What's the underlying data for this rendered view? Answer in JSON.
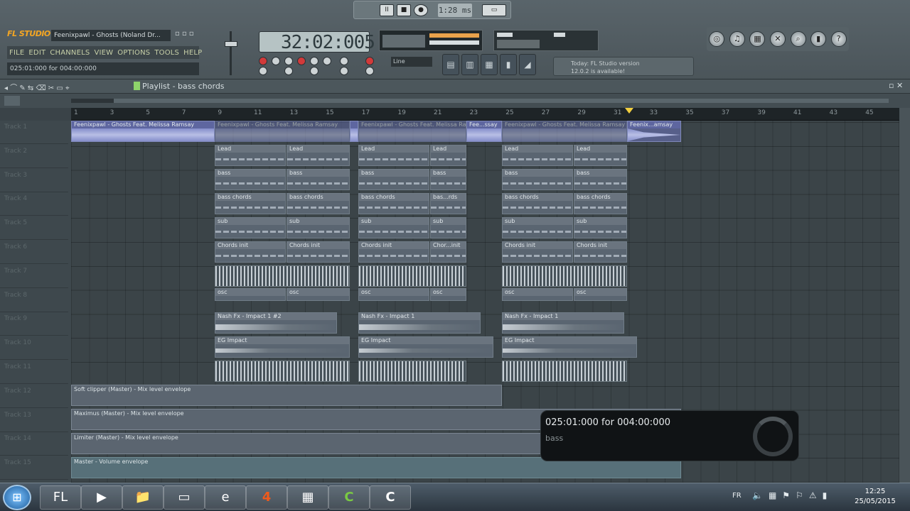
{
  "app": {
    "logo": "FL STUDIO",
    "song_title": "Feenixpawl - Ghosts (Noland Dr...",
    "menu": [
      "FILE",
      "EDIT",
      "CHANNELS",
      "VIEW",
      "OPTIONS",
      "TOOLS",
      "HELP"
    ],
    "hint_bar": "025:01:000 for 004:00:000",
    "tempo_display": "32:02:005",
    "mode_select": "Line",
    "news": [
      "Today: FL Studio version",
      "12.0.2 is available!"
    ]
  },
  "transport": {
    "pause": "II",
    "stop": "■",
    "record": "●",
    "mini_time": "1:28 ms"
  },
  "playlist": {
    "title": "Playlist - bass chords",
    "bars": [
      "1",
      "3",
      "5",
      "7",
      "9",
      "11",
      "13",
      "15",
      "17",
      "19",
      "21",
      "23",
      "25",
      "27",
      "29",
      "31",
      "33",
      "35",
      "37",
      "39",
      "41",
      "43",
      "45"
    ],
    "tracks": [
      "Track 1",
      "Track 2",
      "Track 3",
      "Track 4",
      "Track 5",
      "Track 6",
      "Track 7",
      "Track 8",
      "Track 9",
      "Track 10",
      "Track 11",
      "Track 12",
      "Track 13",
      "Track 14",
      "Track 15"
    ],
    "clips": {
      "audio_main": "Feenixpawl - Ghosts Feat. Melissa Ramsay",
      "audio_2": "Feenixpawl - Ghosts Feat. Melissa Ramsay",
      "audio_3": "Fee...ssay",
      "audio_4": "Feenix...amsay",
      "lead": "Lead",
      "bass": "bass",
      "bass_chords": "bass chords",
      "bass_chords_short": "bas...rds",
      "sub": "sub",
      "chords_init": "Chords init",
      "chords_init_short": "Chor...init",
      "osc": "osc",
      "nash_fx_2": "Nash Fx - Impact 1 #2",
      "nash_fx": "Nash Fx - Impact 1",
      "eg_impact": "EG Impact"
    },
    "envelopes": {
      "soft_clipper": "Soft clipper (Master) - Mix level envelope",
      "maximus": "Maximus (Master) - Mix level envelope",
      "limiter": "Limiter (Master) - Mix level envelope",
      "master": "Master - Volume envelope"
    }
  },
  "hint_popup": {
    "line1": "025:01:000 for 004:00:000",
    "line2": "bass"
  },
  "taskbar": {
    "start": "⊞",
    "apps": [
      "FL",
      "▶",
      "📁",
      "▭",
      "e",
      "4",
      "▦",
      "C",
      "C"
    ],
    "lang": "FR",
    "time": "12:25",
    "date": "25/05/2015"
  }
}
